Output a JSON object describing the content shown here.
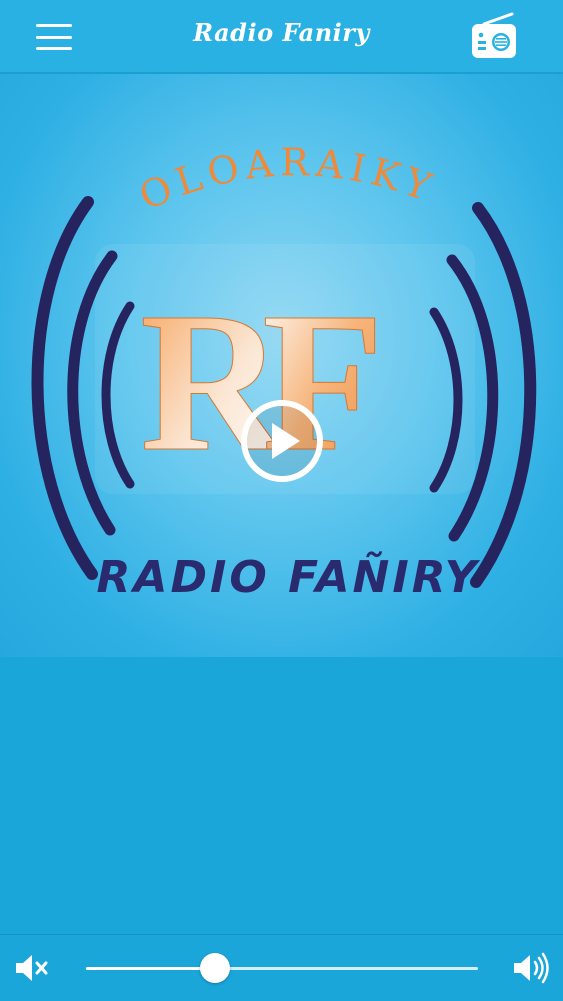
{
  "header": {
    "title": "Radio Faniry",
    "menu_icon": "hamburger-menu-icon",
    "radio_icon": "radio-icon"
  },
  "artwork": {
    "arc_text": "OLOARAIKY",
    "monogram": "RF",
    "station_text": "RADIO FAÑIRY",
    "play_icon": "play-icon"
  },
  "player": {
    "mute_icon": "mute-icon",
    "volume_icon": "volume-icon",
    "volume_level": 0.33
  },
  "colors": {
    "bar": "#29b1e3",
    "background": "#1ba6d9",
    "logo_orange": "#ee8a3c",
    "logo_navy": "#2a2a6e"
  }
}
